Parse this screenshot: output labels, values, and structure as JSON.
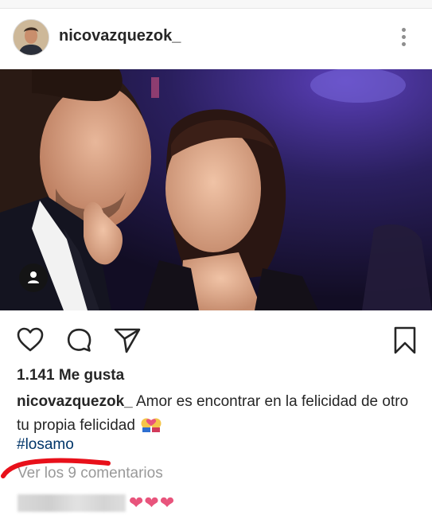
{
  "post": {
    "username": "nicovazquezok_",
    "likes_text": "1.141 Me gusta",
    "caption_user": "nicovazquezok_",
    "caption_text": "Amor es encontrar en la felicidad de otro tu propia felicidad",
    "caption_emoji": "couple-with-heart emoji",
    "hashtag": "#losamo",
    "comments_link": "Ver los 9 comentarios",
    "comment_text": "❤❤❤"
  },
  "icons": {
    "more": "more-options-icon",
    "like": "heart-icon",
    "comment": "comment-bubble-icon",
    "share": "paper-plane-icon",
    "save": "bookmark-icon",
    "tag": "user-tag-icon"
  },
  "colors": {
    "link": "#003569",
    "meta": "#999999",
    "heart": "#e8547c",
    "annotation": "#e8101a"
  }
}
